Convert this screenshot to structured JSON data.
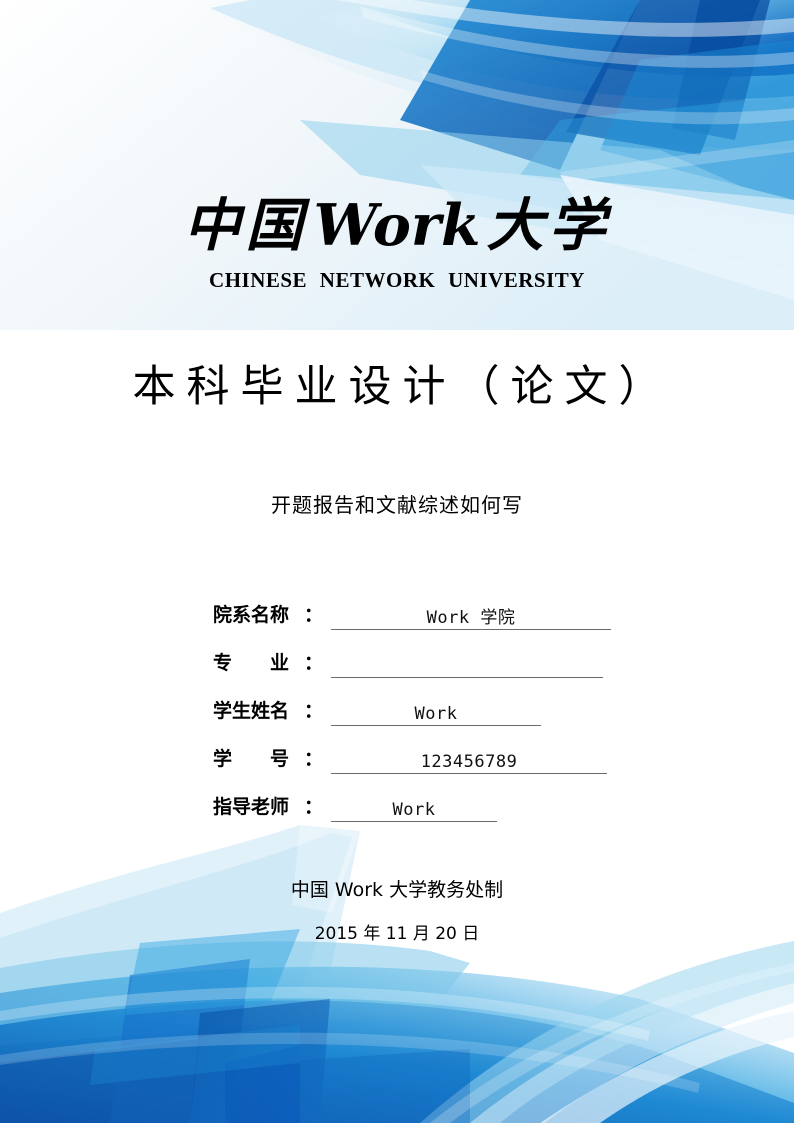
{
  "document": {
    "university_logo_prefix": "中国",
    "university_logo_latin": "Work",
    "university_logo_suffix": "大学",
    "university_english": "CHINESE NETWORK UNIVERSITY",
    "doc_type": "本科毕业设计（论文）",
    "subtitle": "开题报告和文献综述如何写"
  },
  "form": {
    "rows": [
      {
        "label": "院系名称",
        "label_parts": [
          "院",
          "系",
          "名",
          "称"
        ],
        "colon": "：",
        "value": "Work 学院"
      },
      {
        "label": "专　　业",
        "label_parts": [
          "专",
          "业"
        ],
        "colon": "：",
        "value": ""
      },
      {
        "label": "学生姓名",
        "label_parts": [
          "学",
          "生",
          "姓",
          "名"
        ],
        "colon": "：",
        "value": "Work"
      },
      {
        "label": "学　　号",
        "label_parts": [
          "学",
          "号"
        ],
        "colon": "：",
        "value": "123456789"
      },
      {
        "label": "指导老师",
        "label_parts": [
          "指",
          "导",
          "老",
          "师"
        ],
        "colon": "：",
        "value": "Work"
      }
    ]
  },
  "footer": {
    "organization": "中国 Work 大学教务处制",
    "date": "2015 年 11 月 20 日"
  },
  "theme": {
    "accent_dark": "#0B52A8",
    "accent_deep": "#0E63BE",
    "accent_mid": "#1B86D2",
    "accent_bright": "#2FA3E0",
    "accent_light": "#8FD0EC",
    "accent_pale": "#CFE9F7",
    "accent_faint": "#EAF5FC",
    "text_color": "#000000",
    "rule_color": "#6b6b6b",
    "page_background": "#ffffff"
  }
}
